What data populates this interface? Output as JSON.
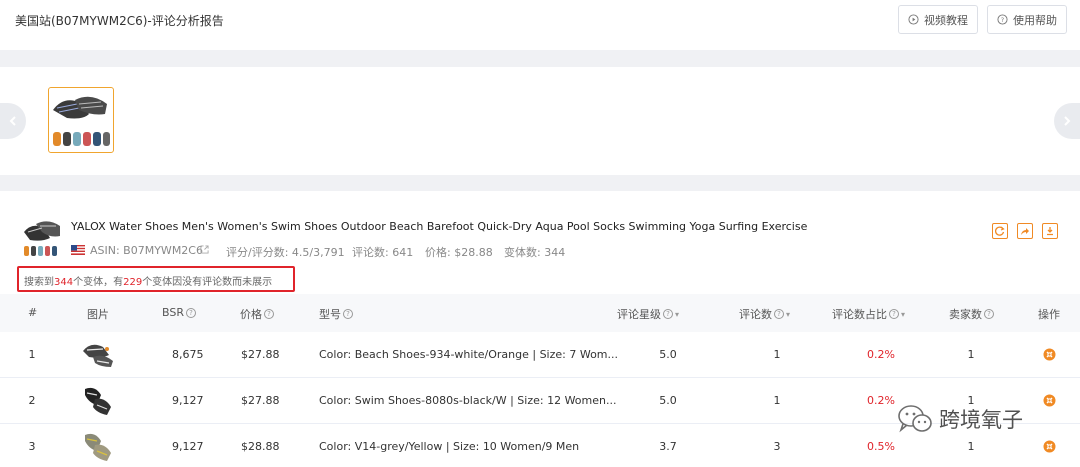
{
  "header": {
    "title": "美国站(B07MYWM2C6)-评论分析报告",
    "video_btn": "视频教程",
    "help_btn": "使用帮助"
  },
  "product": {
    "title": "YALOX Water Shoes Men's Women's Swim Shoes Outdoor Beach Barefoot Quick-Dry Aqua Pool Socks Swimming Yoga Surfing Exercise",
    "asin": "ASIN: B07MYWM2C6",
    "rating": "评分/评分数: 4.5/3,791",
    "reviews": "评论数: 641",
    "price": "价格: $28.88",
    "variants": "变体数: 344"
  },
  "notice": {
    "prefix": "搜索到",
    "found": "344",
    "middle": "个变体，有",
    "hidden": "229",
    "suffix": "个变体因没有评论数而未展示"
  },
  "columns": {
    "index": "#",
    "image": "图片",
    "bsr": "BSR",
    "price": "价格",
    "model": "型号",
    "stars": "评论星级",
    "reviews": "评论数",
    "share": "评论数占比",
    "sellers": "卖家数",
    "action": "操作"
  },
  "rows": [
    {
      "index": "1",
      "bsr": "8,675",
      "price": "$27.88",
      "model": "Color: Beach Shoes-934-white/Orange | Size: 7 Wom...",
      "stars": "5.0",
      "reviews": "1",
      "share": "0.2%",
      "sellers": "1"
    },
    {
      "index": "2",
      "bsr": "9,127",
      "price": "$27.88",
      "model": "Color: Swim Shoes-8080s-black/W | Size: 12 Women...",
      "stars": "5.0",
      "reviews": "1",
      "share": "0.2%",
      "sellers": "1"
    },
    {
      "index": "3",
      "bsr": "9,127",
      "price": "$28.88",
      "model": "Color: V14-grey/Yellow | Size: 10 Women/9 Men",
      "stars": "3.7",
      "reviews": "3",
      "share": "0.5%",
      "sellers": "1"
    }
  ],
  "watermark": "跨境氧子",
  "colors": {
    "accent": "#f08a24",
    "highlight": "#e0242b",
    "selected_thumb": "#f0a52e"
  },
  "icons": {
    "video": "play-circle-icon",
    "help": "question-circle-icon",
    "refresh": "refresh-icon",
    "share": "share-icon",
    "download": "download-icon",
    "operate": "more-circle-icon"
  }
}
